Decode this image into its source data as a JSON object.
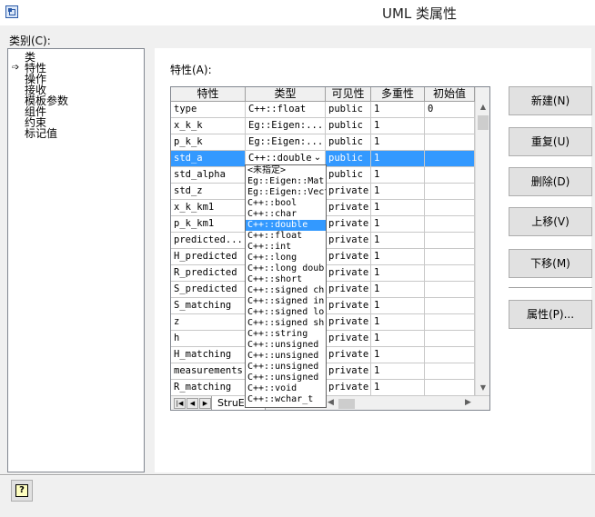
{
  "window": {
    "title": "UML 类属性"
  },
  "categories": {
    "label": "类别(C):",
    "items": [
      "类",
      "特性",
      "操作",
      "接收",
      "模板参数",
      "组件",
      "约束",
      "标记值"
    ],
    "selected_index": 1
  },
  "properties_label": "特性(A):",
  "grid": {
    "headers": [
      "特性",
      "类型",
      "可见性",
      "多重性",
      "初始值"
    ],
    "rows": [
      [
        "type",
        "C++::float",
        "public",
        "1",
        "0"
      ],
      [
        "x_k_k",
        "Eg::Eigen:...",
        "public",
        "1",
        ""
      ],
      [
        "p_k_k",
        "Eg::Eigen:...",
        "public",
        "1",
        ""
      ],
      [
        "std_a",
        "C++::double",
        "public",
        "1",
        ""
      ],
      [
        "std_alpha",
        "",
        "public",
        "1",
        ""
      ],
      [
        "std_z",
        "",
        "private",
        "1",
        ""
      ],
      [
        "x_k_km1",
        "",
        "private",
        "1",
        ""
      ],
      [
        "p_k_km1",
        "",
        "private",
        "1",
        ""
      ],
      [
        "predicted...",
        "",
        "private",
        "1",
        ""
      ],
      [
        "H_predicted",
        "",
        "private",
        "1",
        ""
      ],
      [
        "R_predicted",
        "",
        "private",
        "1",
        ""
      ],
      [
        "S_predicted",
        "",
        "private",
        "1",
        ""
      ],
      [
        "S_matching",
        "",
        "private",
        "1",
        ""
      ],
      [
        "z",
        "",
        "private",
        "1",
        ""
      ],
      [
        "h",
        "",
        "private",
        "1",
        ""
      ],
      [
        "H_matching",
        "",
        "private",
        "1",
        ""
      ],
      [
        "measurements",
        "",
        "private",
        "1",
        ""
      ],
      [
        "R_matching",
        "",
        "private",
        "1",
        ""
      ]
    ],
    "selected_row": 3,
    "sheet_tab": "StruE"
  },
  "type_dropdown": {
    "items": [
      "<未指定>",
      "Eg::Eigen::Matr",
      "Eg::Eigen::Vect",
      "C++::bool",
      "C++::char",
      "C++::double",
      "C++::float",
      "C++::int",
      "C++::long",
      "C++::long doub",
      "C++::short",
      "C++::signed ch",
      "C++::signed in",
      "C++::signed lo",
      "C++::signed sh",
      "C++::string",
      "C++::unsigned",
      "C++::unsigned",
      "C++::unsigned",
      "C++::unsigned",
      "C++::void",
      "C++::wchar_t"
    ],
    "highlighted_index": 5
  },
  "buttons": {
    "new": "新建(N)",
    "repeat": "重复(U)",
    "delete": "删除(D)",
    "move_up": "上移(V)",
    "move_down": "下移(M)",
    "properties": "属性(P)..."
  },
  "icons": {
    "app": "uml-class-icon",
    "help": "help-icon",
    "selected_category_marker": "arrow-right-icon"
  },
  "colors": {
    "selection": "#3399ff",
    "window_bg": "#f0f0f0"
  }
}
